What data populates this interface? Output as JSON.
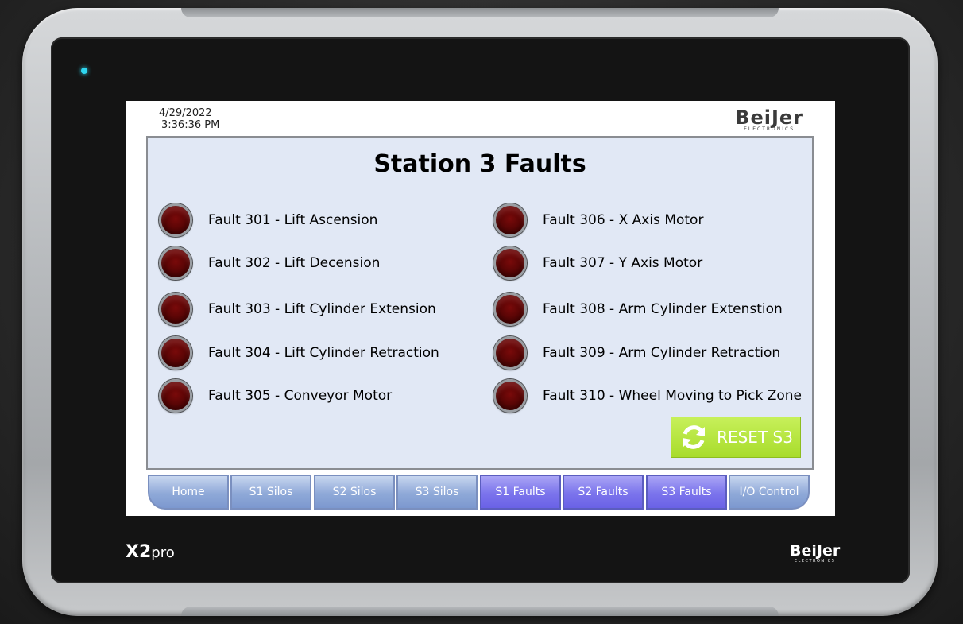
{
  "device": {
    "model_bold": "X2",
    "model_light": "pro",
    "brand": "BeiJer",
    "brand_sub": "ELECTRONICS"
  },
  "header": {
    "date": "4/29/2022",
    "time": "3:36:36 PM",
    "logo_name": "BeiJer",
    "logo_sub": "ELECTRONICS"
  },
  "main": {
    "title": "Station 3 Faults",
    "faults_left": [
      {
        "label": "Fault 301 - Lift Ascension"
      },
      {
        "label": "Fault 302 - Lift Decension"
      },
      {
        "label": "Fault 303 - Lift Cylinder Extension"
      },
      {
        "label": "Fault 304 - Lift Cylinder Retraction"
      },
      {
        "label": "Fault 305 - Conveyor Motor"
      }
    ],
    "faults_right": [
      {
        "label": "Fault 306 - X Axis Motor"
      },
      {
        "label": "Fault 307 - Y Axis Motor"
      },
      {
        "label": "Fault 308 - Arm Cylinder Extenstion"
      },
      {
        "label": "Fault 309 - Arm Cylinder Retraction"
      },
      {
        "label": "Fault 310 - Wheel Moving to Pick Zone"
      }
    ],
    "reset_label": "RESET S3"
  },
  "nav": {
    "buttons": [
      {
        "label": "Home"
      },
      {
        "label": "S1 Silos"
      },
      {
        "label": "S2 Silos"
      },
      {
        "label": "S3 Silos"
      },
      {
        "label": "S1 Faults"
      },
      {
        "label": "S2 Faults"
      },
      {
        "label": "S3 Faults"
      },
      {
        "label": "I/O Control"
      }
    ]
  },
  "colors": {
    "lamp_inactive": "#5a0505",
    "reset_green": "#a8dc2b",
    "nav_plain": "#8fa9d8",
    "nav_fault": "#7b74ec",
    "status_led": "#2fd6f0"
  }
}
